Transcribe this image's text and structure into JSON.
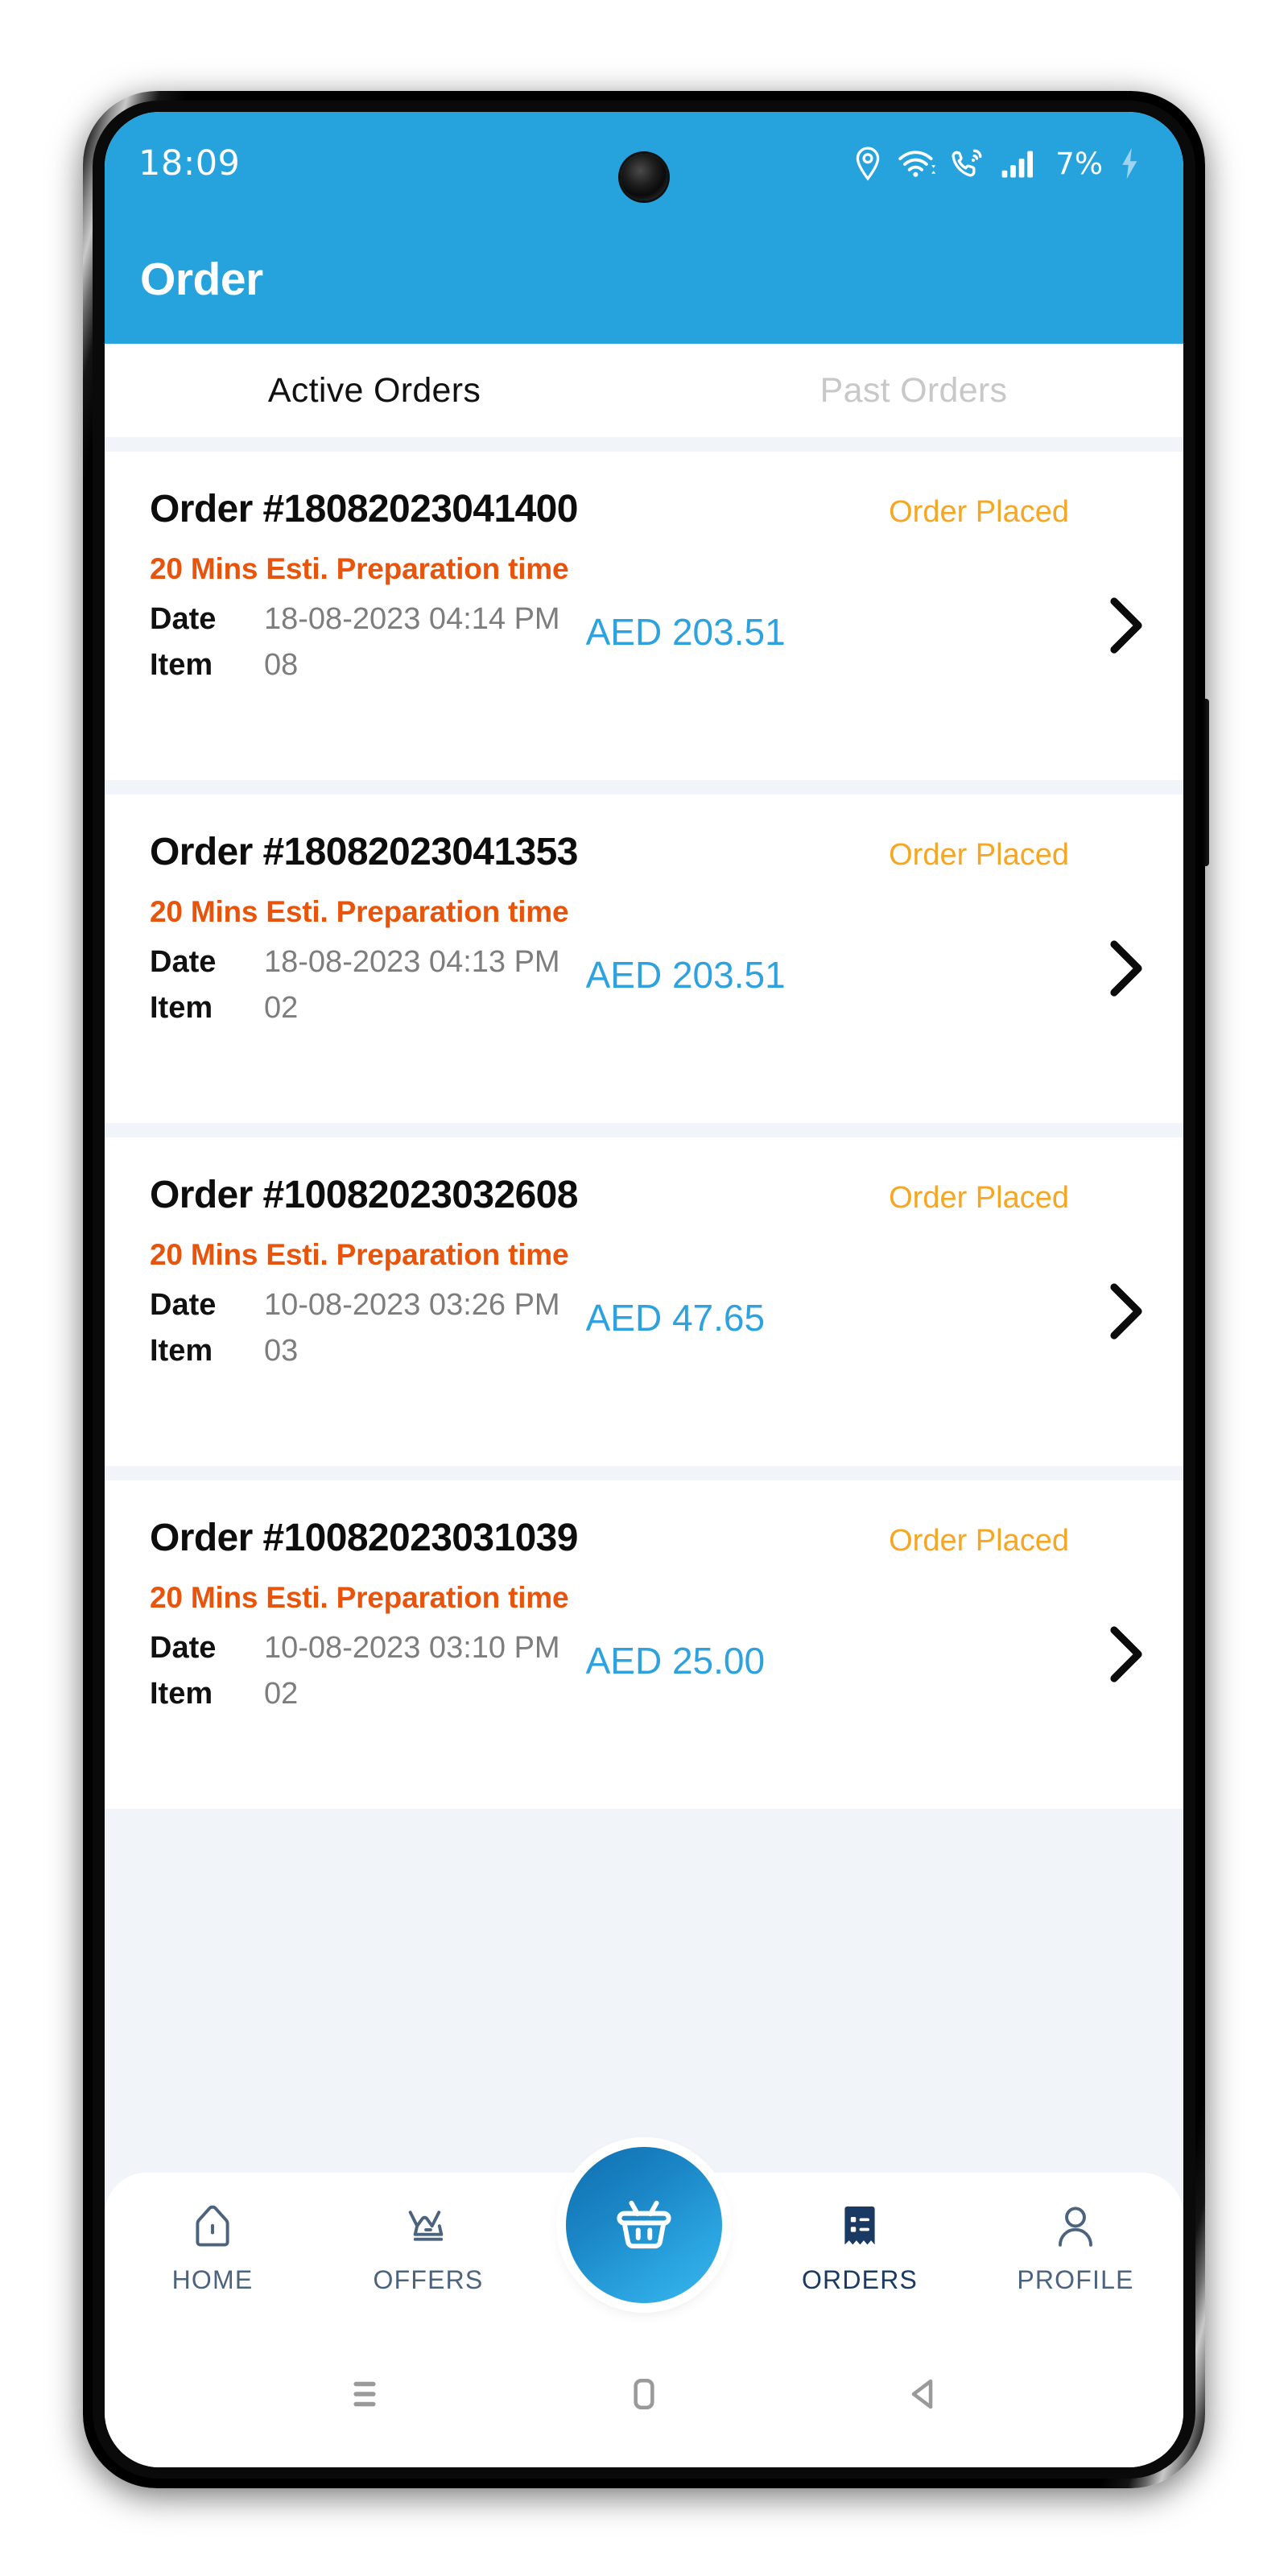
{
  "status_bar": {
    "time": "18:09",
    "battery_percent": "7%",
    "icons": [
      "location-pin-icon",
      "wifi-icon",
      "call-forwarding-icon",
      "signal-bars-icon",
      "charging-bolt-icon"
    ]
  },
  "app_bar": {
    "title": "Order",
    "background_color": "#26a3dd"
  },
  "tabs": [
    {
      "label": "Active Orders",
      "active": true
    },
    {
      "label": "Past Orders",
      "active": false
    }
  ],
  "labels": {
    "date_key": "Date",
    "item_key": "Item"
  },
  "colors": {
    "accent_blue": "#26a3dd",
    "amount_blue": "#2da2de",
    "status_amber": "#f5a623",
    "prep_orange": "#e8540c",
    "list_background": "#f1f5fa",
    "nav_label": "#4c637d",
    "nav_active_label": "#1b3a63"
  },
  "orders": [
    {
      "order_id": "Order #18082023041400",
      "status": "Order Placed",
      "prep_time": "20 Mins  Esti.  Preparation time",
      "date": "18-08-2023 04:14 PM",
      "item_count": "08",
      "amount": "AED 203.51"
    },
    {
      "order_id": "Order #18082023041353",
      "status": "Order Placed",
      "prep_time": "20 Mins  Esti.  Preparation time",
      "date": "18-08-2023 04:13 PM",
      "item_count": "02",
      "amount": "AED 203.51"
    },
    {
      "order_id": "Order #10082023032608",
      "status": "Order Placed",
      "prep_time": "20 Mins  Esti.  Preparation time",
      "date": "10-08-2023 03:26 PM",
      "item_count": "03",
      "amount": "AED 47.65"
    },
    {
      "order_id": "Order #10082023031039",
      "status": "Order Placed",
      "prep_time": "20 Mins  Esti.  Preparation time",
      "date": "10-08-2023 03:10 PM",
      "item_count": "02",
      "amount": "AED 25.00"
    }
  ],
  "bottom_nav": {
    "items": [
      {
        "label": "HOME",
        "icon": "home-icon",
        "active": false
      },
      {
        "label": "OFFERS",
        "icon": "crown-icon",
        "active": false
      },
      {
        "label": "ORDERS",
        "icon": "receipt-list-icon",
        "active": true
      },
      {
        "label": "PROFILE",
        "icon": "person-icon",
        "active": false
      }
    ],
    "fab": {
      "icon": "shopping-basket-icon"
    }
  },
  "system_nav": {
    "buttons": [
      "recents-menu-icon",
      "home-square-icon",
      "back-triangle-icon"
    ]
  }
}
